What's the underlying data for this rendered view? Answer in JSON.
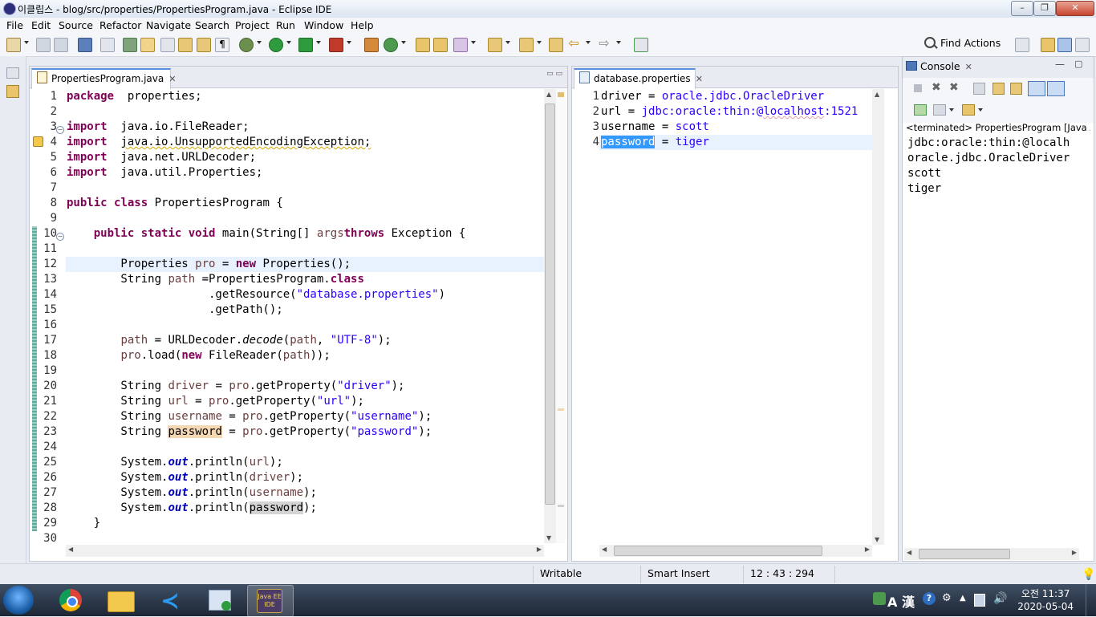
{
  "window": {
    "title": "이클립스 - blog/src/properties/PropertiesProgram.java - Eclipse IDE"
  },
  "menu": [
    "File",
    "Edit",
    "Source",
    "Refactor",
    "Navigate",
    "Search",
    "Project",
    "Run",
    "Window",
    "Help"
  ],
  "toolbar": {
    "find_actions": "Find Actions"
  },
  "editor_left": {
    "tab": "PropertiesProgram.java",
    "lines": [
      {
        "n": "1",
        "segs": [
          [
            "kw",
            "package"
          ],
          [
            "",
            "  properties;"
          ]
        ]
      },
      {
        "n": "2",
        "segs": []
      },
      {
        "n": "3",
        "segs": [
          [
            "kw",
            "import"
          ],
          [
            "",
            "  java.io.FileReader;"
          ]
        ]
      },
      {
        "n": "4",
        "segs": [
          [
            "kw",
            "import"
          ],
          [
            "",
            "  "
          ],
          [
            "squig",
            "java.io.UnsupportedEncodingException;"
          ]
        ]
      },
      {
        "n": "5",
        "segs": [
          [
            "kw",
            "import"
          ],
          [
            "",
            "  java.net.URLDecoder;"
          ]
        ]
      },
      {
        "n": "6",
        "segs": [
          [
            "kw",
            "import"
          ],
          [
            "",
            "  java.util.Properties;"
          ]
        ]
      },
      {
        "n": "7",
        "segs": []
      },
      {
        "n": "8",
        "segs": [
          [
            "kw",
            "public"
          ],
          [
            "",
            " "
          ],
          [
            "kw",
            "class"
          ],
          [
            "",
            " PropertiesProgram {"
          ]
        ]
      },
      {
        "n": "9",
        "segs": []
      },
      {
        "n": "10",
        "segs": [
          [
            "",
            "    "
          ],
          [
            "kw",
            "public"
          ],
          [
            "",
            " "
          ],
          [
            "kw",
            "static"
          ],
          [
            "",
            " "
          ],
          [
            "kw",
            "void"
          ],
          [
            "",
            " main(String[] "
          ],
          [
            "var",
            "args"
          ],
          [
            ") "
          ],
          [
            "kw",
            "throws"
          ],
          [
            "",
            " Exception {"
          ]
        ]
      },
      {
        "n": "11",
        "segs": []
      },
      {
        "n": "12",
        "segs": [
          [
            "",
            "        Properties "
          ],
          [
            "var",
            "pro"
          ],
          [
            "",
            " = "
          ],
          [
            "kw",
            "new"
          ],
          [
            "",
            " Properties();"
          ]
        ]
      },
      {
        "n": "13",
        "segs": [
          [
            "",
            "        String "
          ],
          [
            "var",
            "path"
          ],
          [
            "",
            " =PropertiesProgram."
          ],
          [
            "kw",
            "class"
          ]
        ]
      },
      {
        "n": "14",
        "segs": [
          [
            "",
            "                     .getResource("
          ],
          [
            "str",
            "\"database.properties\""
          ],
          [
            "",
            ")"
          ]
        ]
      },
      {
        "n": "15",
        "segs": [
          [
            "",
            "                     .getPath();"
          ]
        ]
      },
      {
        "n": "16",
        "segs": []
      },
      {
        "n": "17",
        "segs": [
          [
            "",
            "        "
          ],
          [
            "var",
            "path"
          ],
          [
            "",
            " = URLDecoder."
          ],
          [
            "ital",
            "decode"
          ],
          [
            "",
            "("
          ],
          [
            "var",
            "path"
          ],
          [
            "",
            ", "
          ],
          [
            "str",
            "\"UTF-8\""
          ],
          [
            "",
            ");"
          ]
        ]
      },
      {
        "n": "18",
        "segs": [
          [
            "",
            "        "
          ],
          [
            "var",
            "pro"
          ],
          [
            "",
            ".load("
          ],
          [
            "kw",
            "new"
          ],
          [
            "",
            " FileReader("
          ],
          [
            "var",
            "path"
          ],
          [
            "",
            "));"
          ]
        ]
      },
      {
        "n": "19",
        "segs": []
      },
      {
        "n": "20",
        "segs": [
          [
            "",
            "        String "
          ],
          [
            "var",
            "driver"
          ],
          [
            "",
            " = "
          ],
          [
            "var",
            "pro"
          ],
          [
            "",
            ".getProperty("
          ],
          [
            "str",
            "\"driver\""
          ],
          [
            "",
            ");"
          ]
        ]
      },
      {
        "n": "21",
        "segs": [
          [
            "",
            "        String "
          ],
          [
            "var",
            "url"
          ],
          [
            "",
            " = "
          ],
          [
            "var",
            "pro"
          ],
          [
            "",
            ".getProperty("
          ],
          [
            "str",
            "\"url\""
          ],
          [
            "",
            ");"
          ]
        ]
      },
      {
        "n": "22",
        "segs": [
          [
            "",
            "        String "
          ],
          [
            "var",
            "username"
          ],
          [
            "",
            " = "
          ],
          [
            "var",
            "pro"
          ],
          [
            "",
            ".getProperty("
          ],
          [
            "str",
            "\"username\""
          ],
          [
            "",
            ");"
          ]
        ]
      },
      {
        "n": "23",
        "segs": [
          [
            "",
            "        String "
          ],
          [
            "occ",
            "password"
          ],
          [
            "",
            " = "
          ],
          [
            "var",
            "pro"
          ],
          [
            "",
            ".getProperty("
          ],
          [
            "str",
            "\"password\""
          ],
          [
            "",
            ");"
          ]
        ]
      },
      {
        "n": "24",
        "segs": []
      },
      {
        "n": "25",
        "segs": [
          [
            "",
            "        System."
          ],
          [
            "fld",
            "out"
          ],
          [
            "",
            ".println("
          ],
          [
            "var",
            "url"
          ],
          [
            "",
            ");"
          ]
        ]
      },
      {
        "n": "26",
        "segs": [
          [
            "",
            "        System."
          ],
          [
            "fld",
            "out"
          ],
          [
            "",
            ".println("
          ],
          [
            "var",
            "driver"
          ],
          [
            "",
            ");"
          ]
        ]
      },
      {
        "n": "27",
        "segs": [
          [
            "",
            "        System."
          ],
          [
            "fld",
            "out"
          ],
          [
            "",
            ".println("
          ],
          [
            "var",
            "username"
          ],
          [
            "",
            ");"
          ]
        ]
      },
      {
        "n": "28",
        "segs": [
          [
            "",
            "        System."
          ],
          [
            "fld",
            "out"
          ],
          [
            "",
            ".println("
          ],
          [
            "occ2",
            "password"
          ],
          [
            "",
            ");"
          ]
        ]
      },
      {
        "n": "29",
        "segs": [
          [
            "",
            "    }"
          ]
        ]
      },
      {
        "n": "30",
        "segs": []
      }
    ]
  },
  "editor_right": {
    "tab": "database.properties",
    "lines": [
      {
        "n": "1",
        "segs": [
          [
            "pkey",
            "driver"
          ],
          [
            "",
            " = "
          ],
          [
            "pval",
            "oracle.jdbc.OracleDriver"
          ]
        ]
      },
      {
        "n": "2",
        "segs": [
          [
            "pkey",
            "url"
          ],
          [
            "",
            " = "
          ],
          [
            "pval",
            "jdbc:oracle:thin:@"
          ],
          [
            "squig-r pval",
            "localhost"
          ],
          [
            "pval",
            ":1521"
          ]
        ]
      },
      {
        "n": "3",
        "segs": [
          [
            "pkey",
            "username"
          ],
          [
            "",
            " = "
          ],
          [
            "pval",
            "scott"
          ]
        ]
      },
      {
        "n": "4",
        "segs": [
          [
            "sel",
            "password"
          ],
          [
            "",
            " = "
          ],
          [
            "pval",
            "tiger"
          ]
        ]
      }
    ]
  },
  "console": {
    "tab": "Console",
    "header": "<terminated> PropertiesProgram [Java App",
    "output": [
      "jdbc:oracle:thin:@localh",
      "oracle.jdbc.OracleDriver",
      "scott",
      "tiger"
    ]
  },
  "status": {
    "writable": "Writable",
    "insert_mode": "Smart Insert",
    "position": "12 : 43 : 294"
  },
  "taskbar": {
    "time": "오전 11:37",
    "date": "2020-05-04",
    "ime": "A 漢"
  }
}
